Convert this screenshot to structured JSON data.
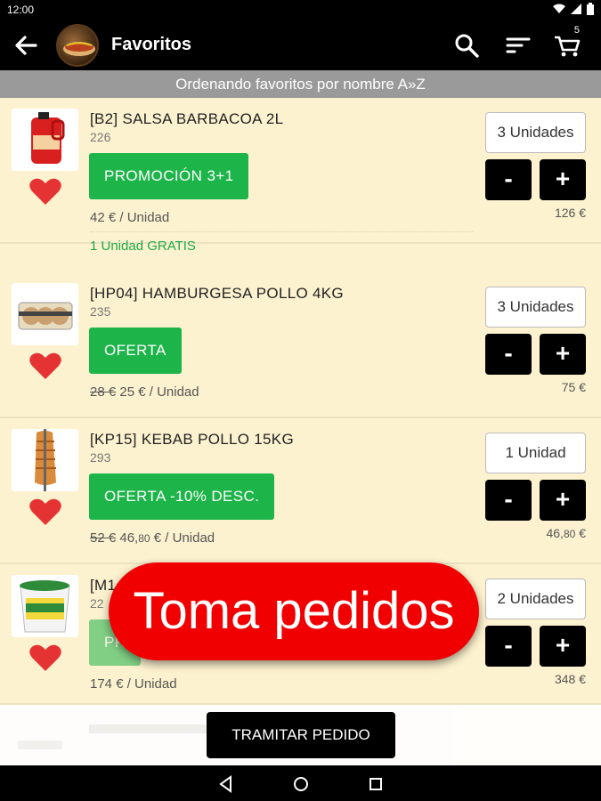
{
  "status": {
    "time": "12:00"
  },
  "toolbar": {
    "title": "Favoritos",
    "cart_count": "5"
  },
  "sortbar": {
    "text": "Ordenando favoritos por nombre A»Z"
  },
  "items": [
    {
      "name": "[B2] SALSA BARBACOA 2L",
      "code": "226",
      "promo": "PROMOCIÓN 3+1",
      "price_unit": "42 € / Unidad",
      "gift": "1 Unidad GRATIS",
      "qty": "3 Unidades",
      "total": "126 €"
    },
    {
      "name": "[HP04] HAMBURGESA POLLO 4KG",
      "code": "235",
      "promo": "OFERTA",
      "price_old": "28 €",
      "price_new": "25 € / Unidad",
      "qty": "3 Unidades",
      "total": "75 €"
    },
    {
      "name": "[KP15] KEBAB POLLO 15KG",
      "code": "293",
      "promo": "OFERTA -10% DESC.",
      "price_old": "52 €",
      "price_main": "46,",
      "price_cents": "80",
      "price_suffix": " € / Unidad",
      "qty": "1 Unidad",
      "total_main": "46,",
      "total_cents": "80",
      "total_suffix": " €"
    },
    {
      "name": "[M1",
      "code": "22",
      "promo": "PR",
      "price_unit": "174 € / Unidad",
      "qty": "2 Unidades",
      "total": "348 €"
    }
  ],
  "buttons": {
    "minus": "-",
    "plus": "+",
    "checkout": "TRAMITAR PEDIDO"
  },
  "banner": {
    "text": "Toma pedidos"
  },
  "colors": {
    "accent_green": "#1db44a",
    "banner_red": "#f00000",
    "list_bg": "#fdf2cf"
  }
}
